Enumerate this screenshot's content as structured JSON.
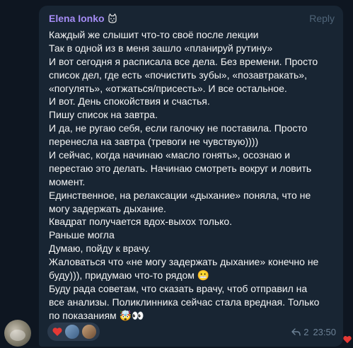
{
  "message": {
    "author": "Elena Ionko",
    "reply_label": "Reply",
    "lines": [
      "Каждый же слышит что-то своё после лекции",
      "Так в одной из в меня зашло «планируй рутину»",
      "И вот сегодня я расписала все дела. Без времени. Просто",
      "список дел, где есть «почистить зубы», «позавтракать»,",
      "«погулять», «отжаться/присесть». И все остальное.",
      "И вот. День спокойствия и счастья.",
      "Пишу список на завтра.",
      "И да, не ругаю себя, если галочку не поставила. Просто",
      "перенесла на завтра (тревоги не чувствую))))",
      "И сейчас, когда начинаю «масло гонять», осознаю и",
      "перестаю это делать. Начинаю смотреть вокруг и ловить",
      "момент.",
      "Единственное, на релаксации «дыхание» поняла, что не",
      "могу задержать дыхание.",
      "Квадрат получается вдох-выхох только.",
      "Раньше могла",
      "Думаю, пойду к врачу.",
      "Жаловаться что «не могу задержать дыхание» конечно не",
      "буду))), придумаю что-то рядом",
      "Буду рада советам, что сказать врачу, чтоб отправил на",
      "все анализы. Поликлинника сейчас стала вредная. Только",
      "по показаниям"
    ],
    "line19_emoji": "😬",
    "last_line_emoji": "🤯👀",
    "reply_count": "2",
    "time": "23:50"
  },
  "colors": {
    "background": "#0e1621",
    "bubble": "#182533",
    "author": "#a58cf5",
    "text": "#f5f5f5",
    "meta": "#6d8296",
    "reaction_heart": "#e53935"
  },
  "icons": {
    "author_badge": "cat-face-icon",
    "reaction": "heart-icon",
    "reply": "reply-arrow-icon",
    "corner": "heart-icon"
  }
}
